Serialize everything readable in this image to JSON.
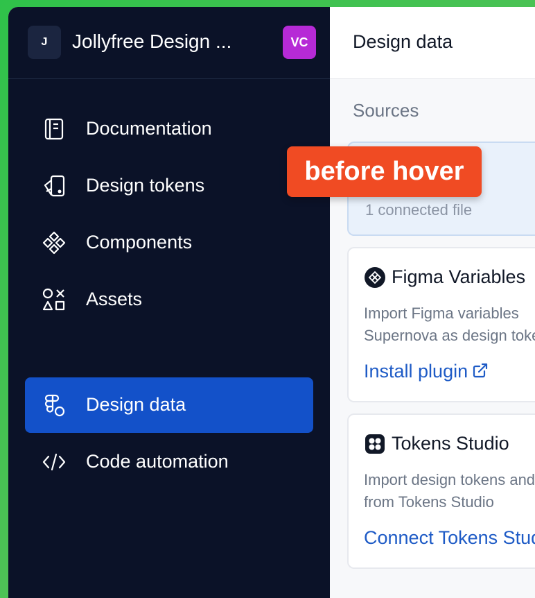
{
  "sidebar": {
    "workspace_initial": "J",
    "workspace_name": "Jollyfree Design ...",
    "user_initials": "VC",
    "items": [
      {
        "label": "Documentation",
        "icon": "documentation-icon"
      },
      {
        "label": "Design tokens",
        "icon": "design-tokens-icon"
      },
      {
        "label": "Components",
        "icon": "components-icon"
      },
      {
        "label": "Assets",
        "icon": "assets-icon"
      },
      {
        "label": "Design data",
        "icon": "design-data-icon",
        "active": true
      },
      {
        "label": "Code automation",
        "icon": "code-icon"
      }
    ]
  },
  "main": {
    "title": "Design data",
    "sources_heading": "Sources",
    "connected_card": {
      "subtitle": "1 connected file"
    },
    "figma_card": {
      "title": "Figma Variables",
      "desc_line1": "Import Figma variables",
      "desc_line2": "Supernova as design tokens",
      "link": "Install plugin"
    },
    "tokens_card": {
      "title": "Tokens Studio",
      "desc_line1": "Import design tokens and",
      "desc_line2": "from Tokens Studio",
      "link": "Connect Tokens Studio"
    }
  },
  "annotation": {
    "label": "before hover"
  },
  "colors": {
    "sidebar_bg": "#0b1228",
    "active_item": "#1351c9",
    "user_avatar": "#b62ad6",
    "badge": "#f04b23",
    "link": "#1e5bc6"
  }
}
